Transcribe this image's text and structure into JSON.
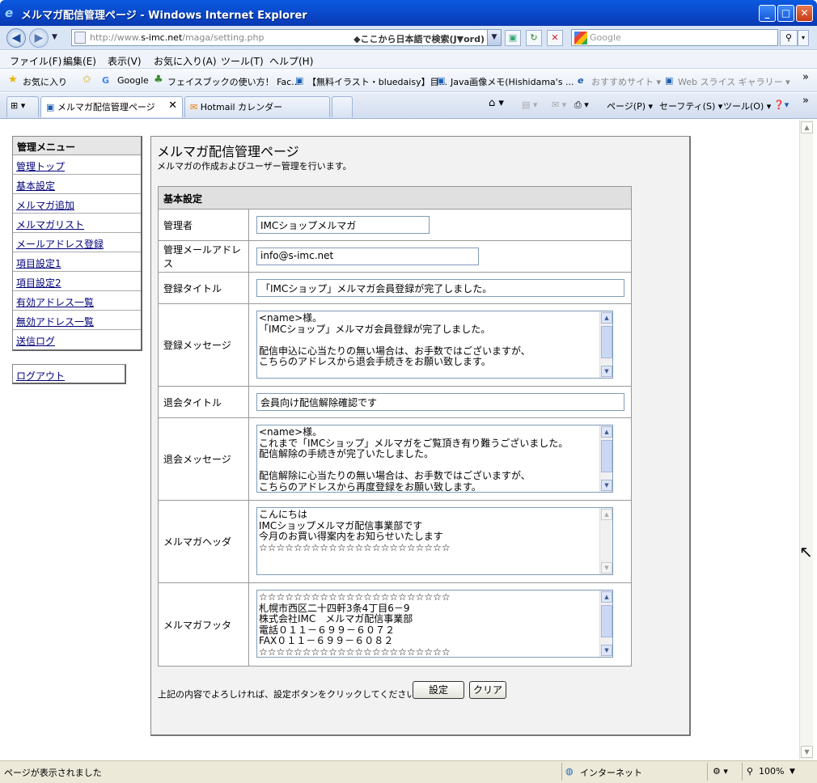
{
  "window": {
    "title": "メルマガ配信管理ページ - Windows Internet Explorer"
  },
  "address": {
    "url_prefix": "http://www.",
    "url_domain": "s-imc.net",
    "url_path": "/maga/setting.php",
    "search_hint": "◆ここから日本語で検索(J▼ord)",
    "search_placeholder": "Google"
  },
  "menu": [
    "ファイル(F)",
    "編集(E)",
    "表示(V)",
    "お気に入り(A)",
    "ツール(T)",
    "ヘルプ(H)"
  ],
  "favorites": {
    "label": "お気に入り",
    "links": [
      "Google",
      "フェイスブックの使い方！ Fac...",
      "【無料イラスト・bluedaisy】目...",
      "Java画像メモ(Hishidama's ...",
      "おすすめサイト ▾",
      "Web スライス ギャラリー ▾"
    ]
  },
  "tabs": [
    {
      "label": "メルマガ配信管理ページ"
    },
    {
      "label": "Hotmail カレンダー"
    }
  ],
  "commands": [
    "ページ(P) ▾",
    "セーフティ(S) ▾",
    "ツール(O) ▾"
  ],
  "sidebar": {
    "header": "管理メニュー",
    "items": [
      "管理トップ",
      "基本設定",
      "メルマガ追加",
      "メルマガリスト",
      "メールアドレス登録",
      "項目設定1",
      "項目設定2",
      "有効アドレス一覧",
      "無効アドレス一覧",
      "送信ログ"
    ],
    "logout": "ログアウト"
  },
  "main": {
    "title": "メルマガ配信管理ページ",
    "description": "メルマガの作成およびユーザー管理を行います。",
    "section": "基本設定",
    "fields": {
      "admin": {
        "label": "管理者",
        "value": "IMCショップメルマガ"
      },
      "admin_email": {
        "label": "管理メールアドレス",
        "value": "info@s-imc.net"
      },
      "reg_title": {
        "label": "登録タイトル",
        "value": "「IMCショップ」メルマガ会員登録が完了しました。"
      },
      "reg_message": {
        "label": "登録メッセージ",
        "value": "<name>様。\n「IMCショップ」メルマガ会員登録が完了しました。\n\n配信申込に心当たりの無い場合は、お手数ではございますが、\nこちらのアドレスから退会手続きをお願い致します。"
      },
      "unsub_title": {
        "label": "退会タイトル",
        "value": "会員向け配信解除確認です"
      },
      "unsub_message": {
        "label": "退会メッセージ",
        "value": "<name>様。\nこれまで「IMCショップ」メルマガをご覧頂き有り難うございました。\n配信解除の手続きが完了いたしました。\n\n配信解除に心当たりの無い場合は、お手数ではございますが、\nこちらのアドレスから再度登録をお願い致します。"
      },
      "header": {
        "label": "メルマガヘッダ",
        "value": "こんにちは\nIMCショップメルマガ配信事業部です\n今月のお買い得案内をお知らせいたします\n☆☆☆☆☆☆☆☆☆☆☆☆☆☆☆☆☆☆☆☆☆☆"
      },
      "footer": {
        "label": "メルマガフッタ",
        "value": "☆☆☆☆☆☆☆☆☆☆☆☆☆☆☆☆☆☆☆☆☆☆\n札幌市西区二十四軒3条4丁目6－9\n株式会社IMC　メルマガ配信事業部\n電話０１１－６９９－６０７２\nFAX０１１－６９９－６０８２\n☆☆☆☆☆☆☆☆☆☆☆☆☆☆☆☆☆☆☆☆☆☆"
      }
    },
    "note": "上記の内容でよろしければ、設定ボタンをクリックしてください。",
    "submit_label": "設定",
    "clear_label": "クリア"
  },
  "status": {
    "left": "ページが表示されました",
    "zone": "インターネット",
    "zoom": "100%"
  }
}
